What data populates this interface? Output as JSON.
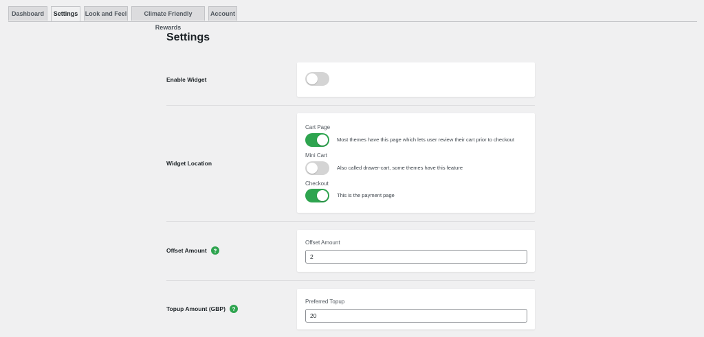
{
  "tabs": [
    {
      "label": "Dashboard",
      "active": false
    },
    {
      "label": "Settings",
      "active": true
    },
    {
      "label": "Look and Feel",
      "active": false
    },
    {
      "label": "Climate Friendly Rewards",
      "active": false
    },
    {
      "label": "Account",
      "active": false
    }
  ],
  "page_title": "Settings",
  "enable_widget": {
    "label": "Enable Widget",
    "enabled": false
  },
  "widget_location": {
    "label": "Widget Location",
    "options": [
      {
        "title": "Cart Page",
        "description": "Most themes have this page which lets user review their cart prior to checkout",
        "enabled": true
      },
      {
        "title": "Mini Cart",
        "description": "Also called drawer-cart, some themes have this feature",
        "enabled": false
      },
      {
        "title": "Checkout",
        "description": "This is the payment page",
        "enabled": true
      }
    ]
  },
  "offset_amount": {
    "label": "Offset Amount",
    "field_label": "Offset Amount",
    "value": "2",
    "icon": "help-icon"
  },
  "topup_amount": {
    "label": "Topup Amount (GBP)",
    "field_label": "Preferred Topup",
    "value": "20",
    "icon": "help-icon"
  },
  "colors": {
    "accent": "#2ea44f",
    "toggle_off": "#d4d4d4",
    "background": "#f0f0f1"
  }
}
